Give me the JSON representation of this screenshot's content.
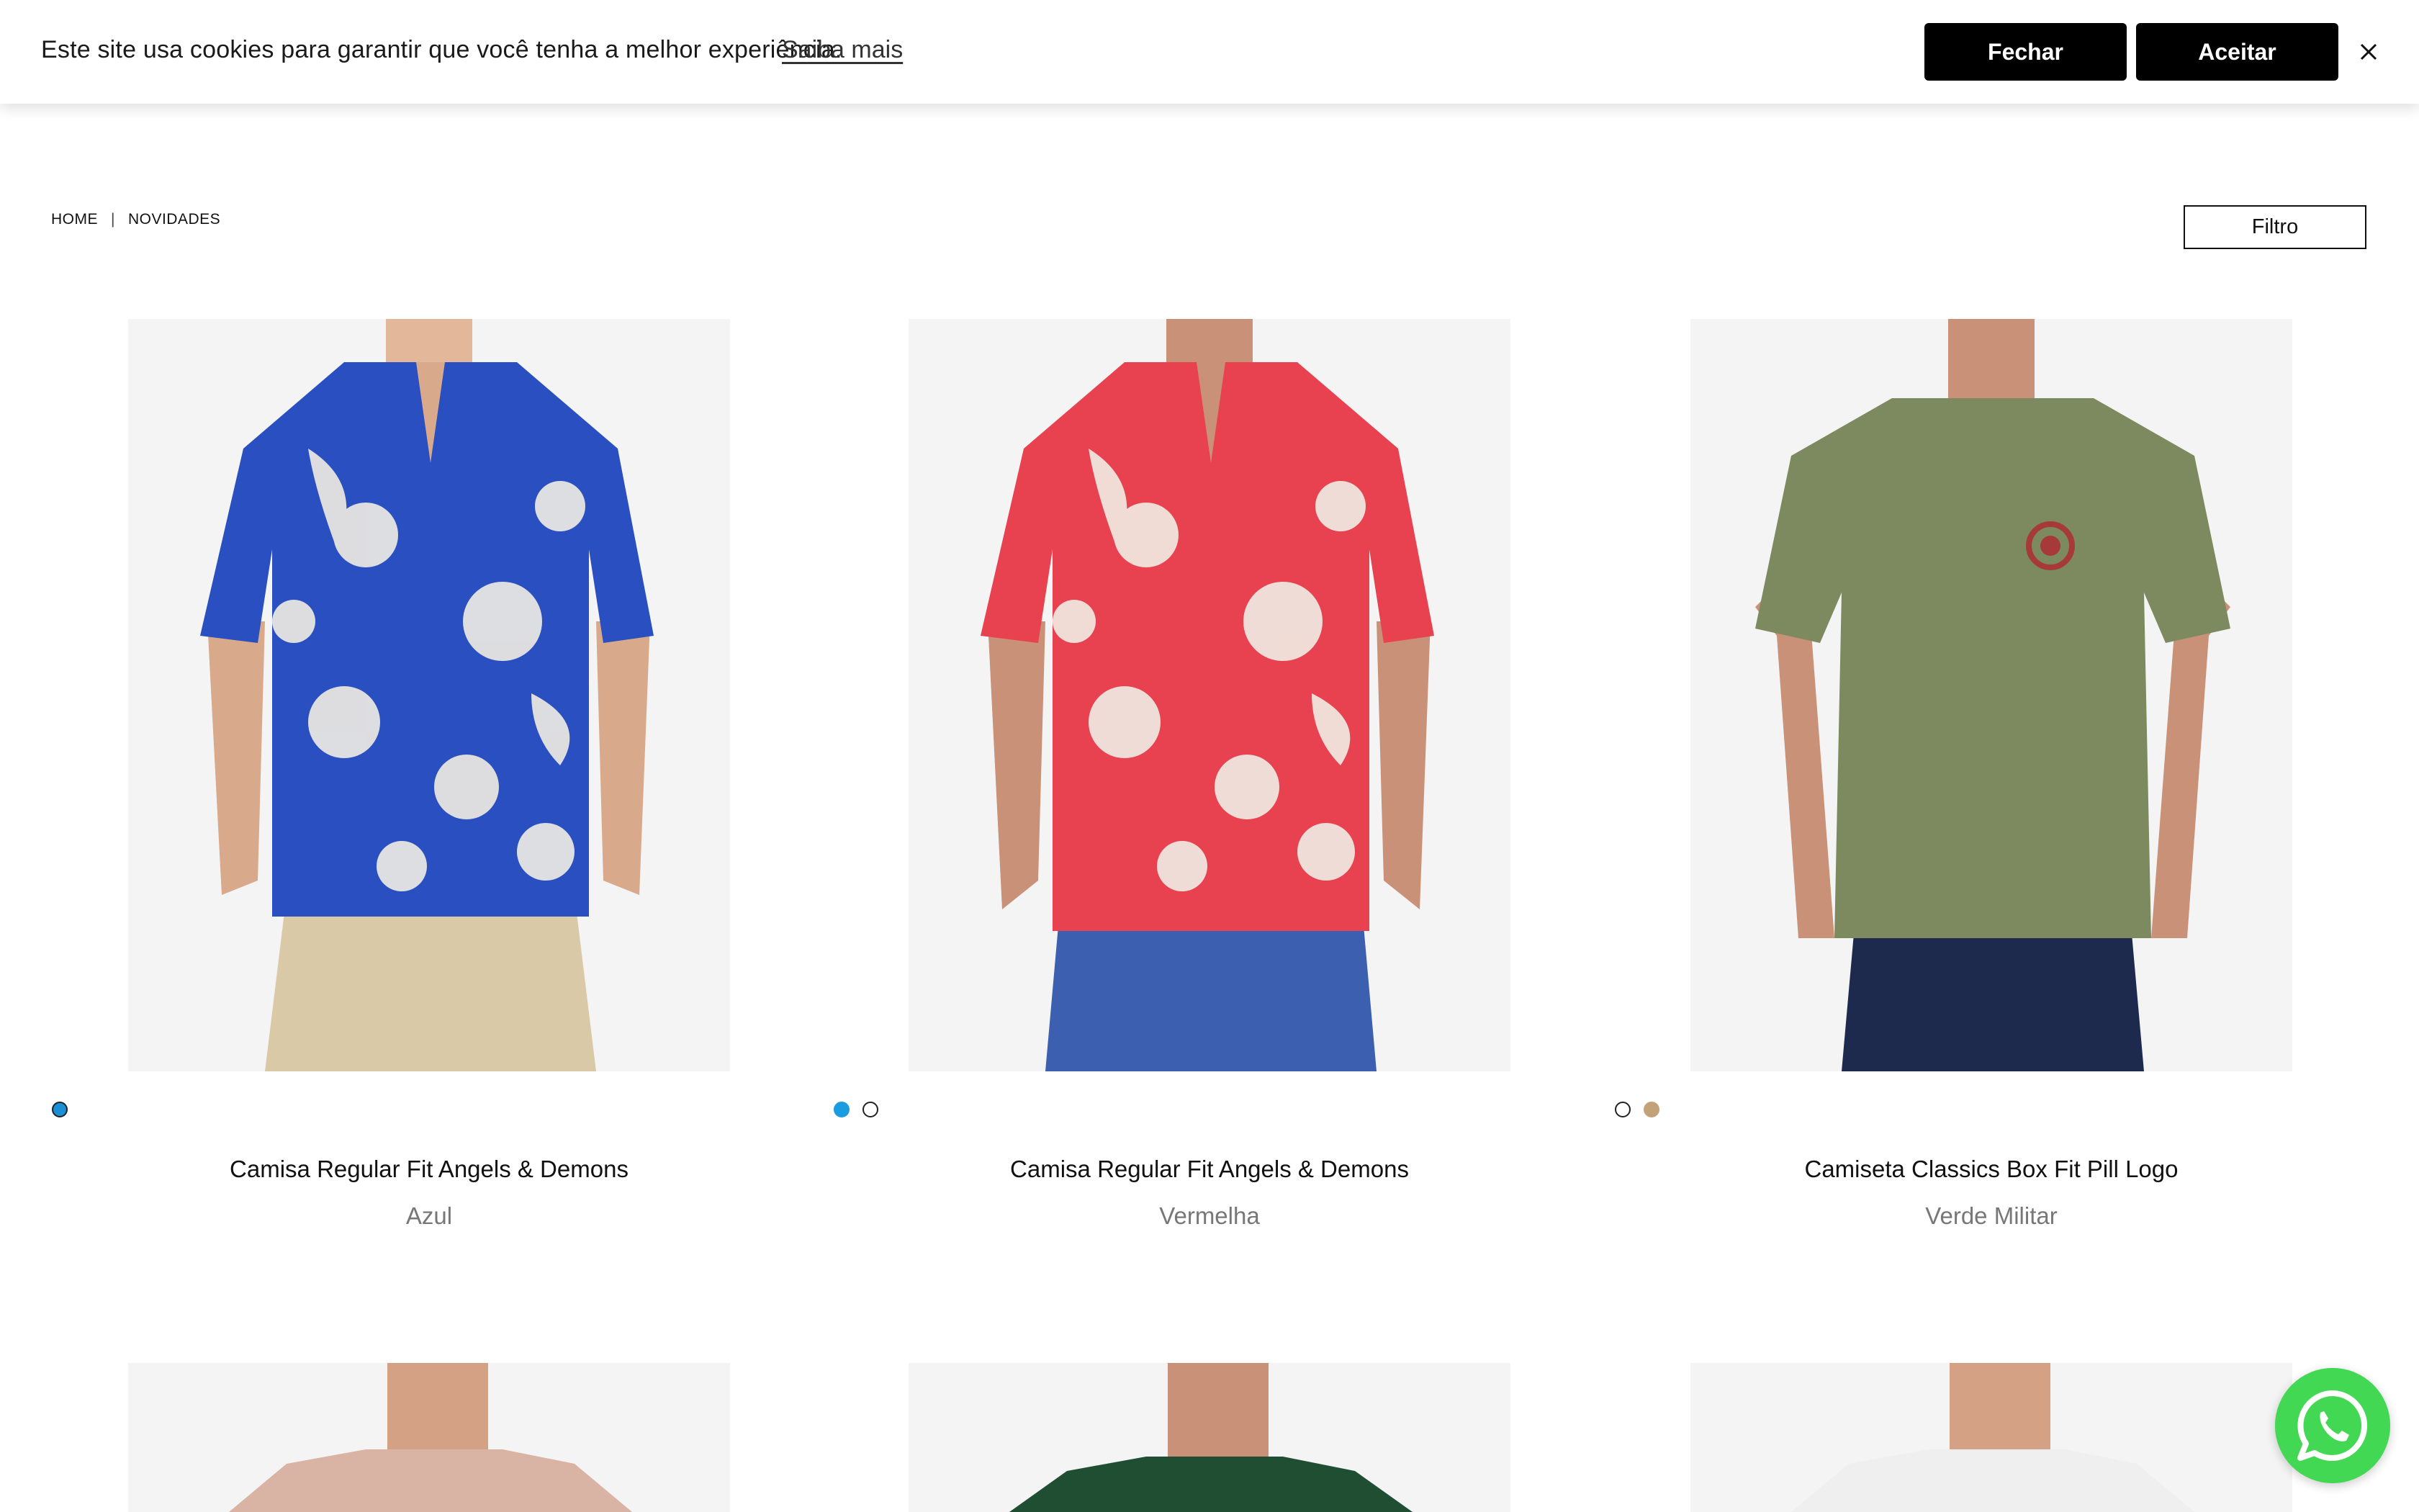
{
  "cookie_bar": {
    "message": "Este site usa cookies para garantir que você tenha a melhor experiência.",
    "learn_more": "Saiba mais",
    "close_label": "Fechar",
    "accept_label": "Aceitar",
    "dismiss_icon": "close-icon"
  },
  "breadcrumb": {
    "home": "HOME",
    "separator": "|",
    "current": "NOVIDADES"
  },
  "filter": {
    "label": "Filtro"
  },
  "products": [
    {
      "name": "Camisa Regular Fit Angels & Demons",
      "color": "Azul",
      "swatches": [
        "#1b8fd6"
      ],
      "shirt_color": "#2a4fc0",
      "pants_color": "#d9c9a7"
    },
    {
      "name": "Camisa Regular Fit Angels & Demons",
      "color": "Vermelha",
      "swatches": [
        "#1b9be0",
        "#ffffff"
      ],
      "shirt_color": "#e8414f",
      "pants_color": "#3d5fb0"
    },
    {
      "name": "Camiseta Classics Box Fit Pill Logo",
      "color": "Verde Militar",
      "swatches": [
        "#ffffff",
        "#c3a27a"
      ],
      "shirt_color": "#7d8a60",
      "pants_color": "#1d2a4d"
    }
  ],
  "row2_products": [
    {
      "shirt_color": "#d9b3a3"
    },
    {
      "shirt_color": "#1f4e32"
    },
    {
      "shirt_color": "#efefef"
    }
  ],
  "whatsapp": {
    "icon": "whatsapp-icon"
  }
}
